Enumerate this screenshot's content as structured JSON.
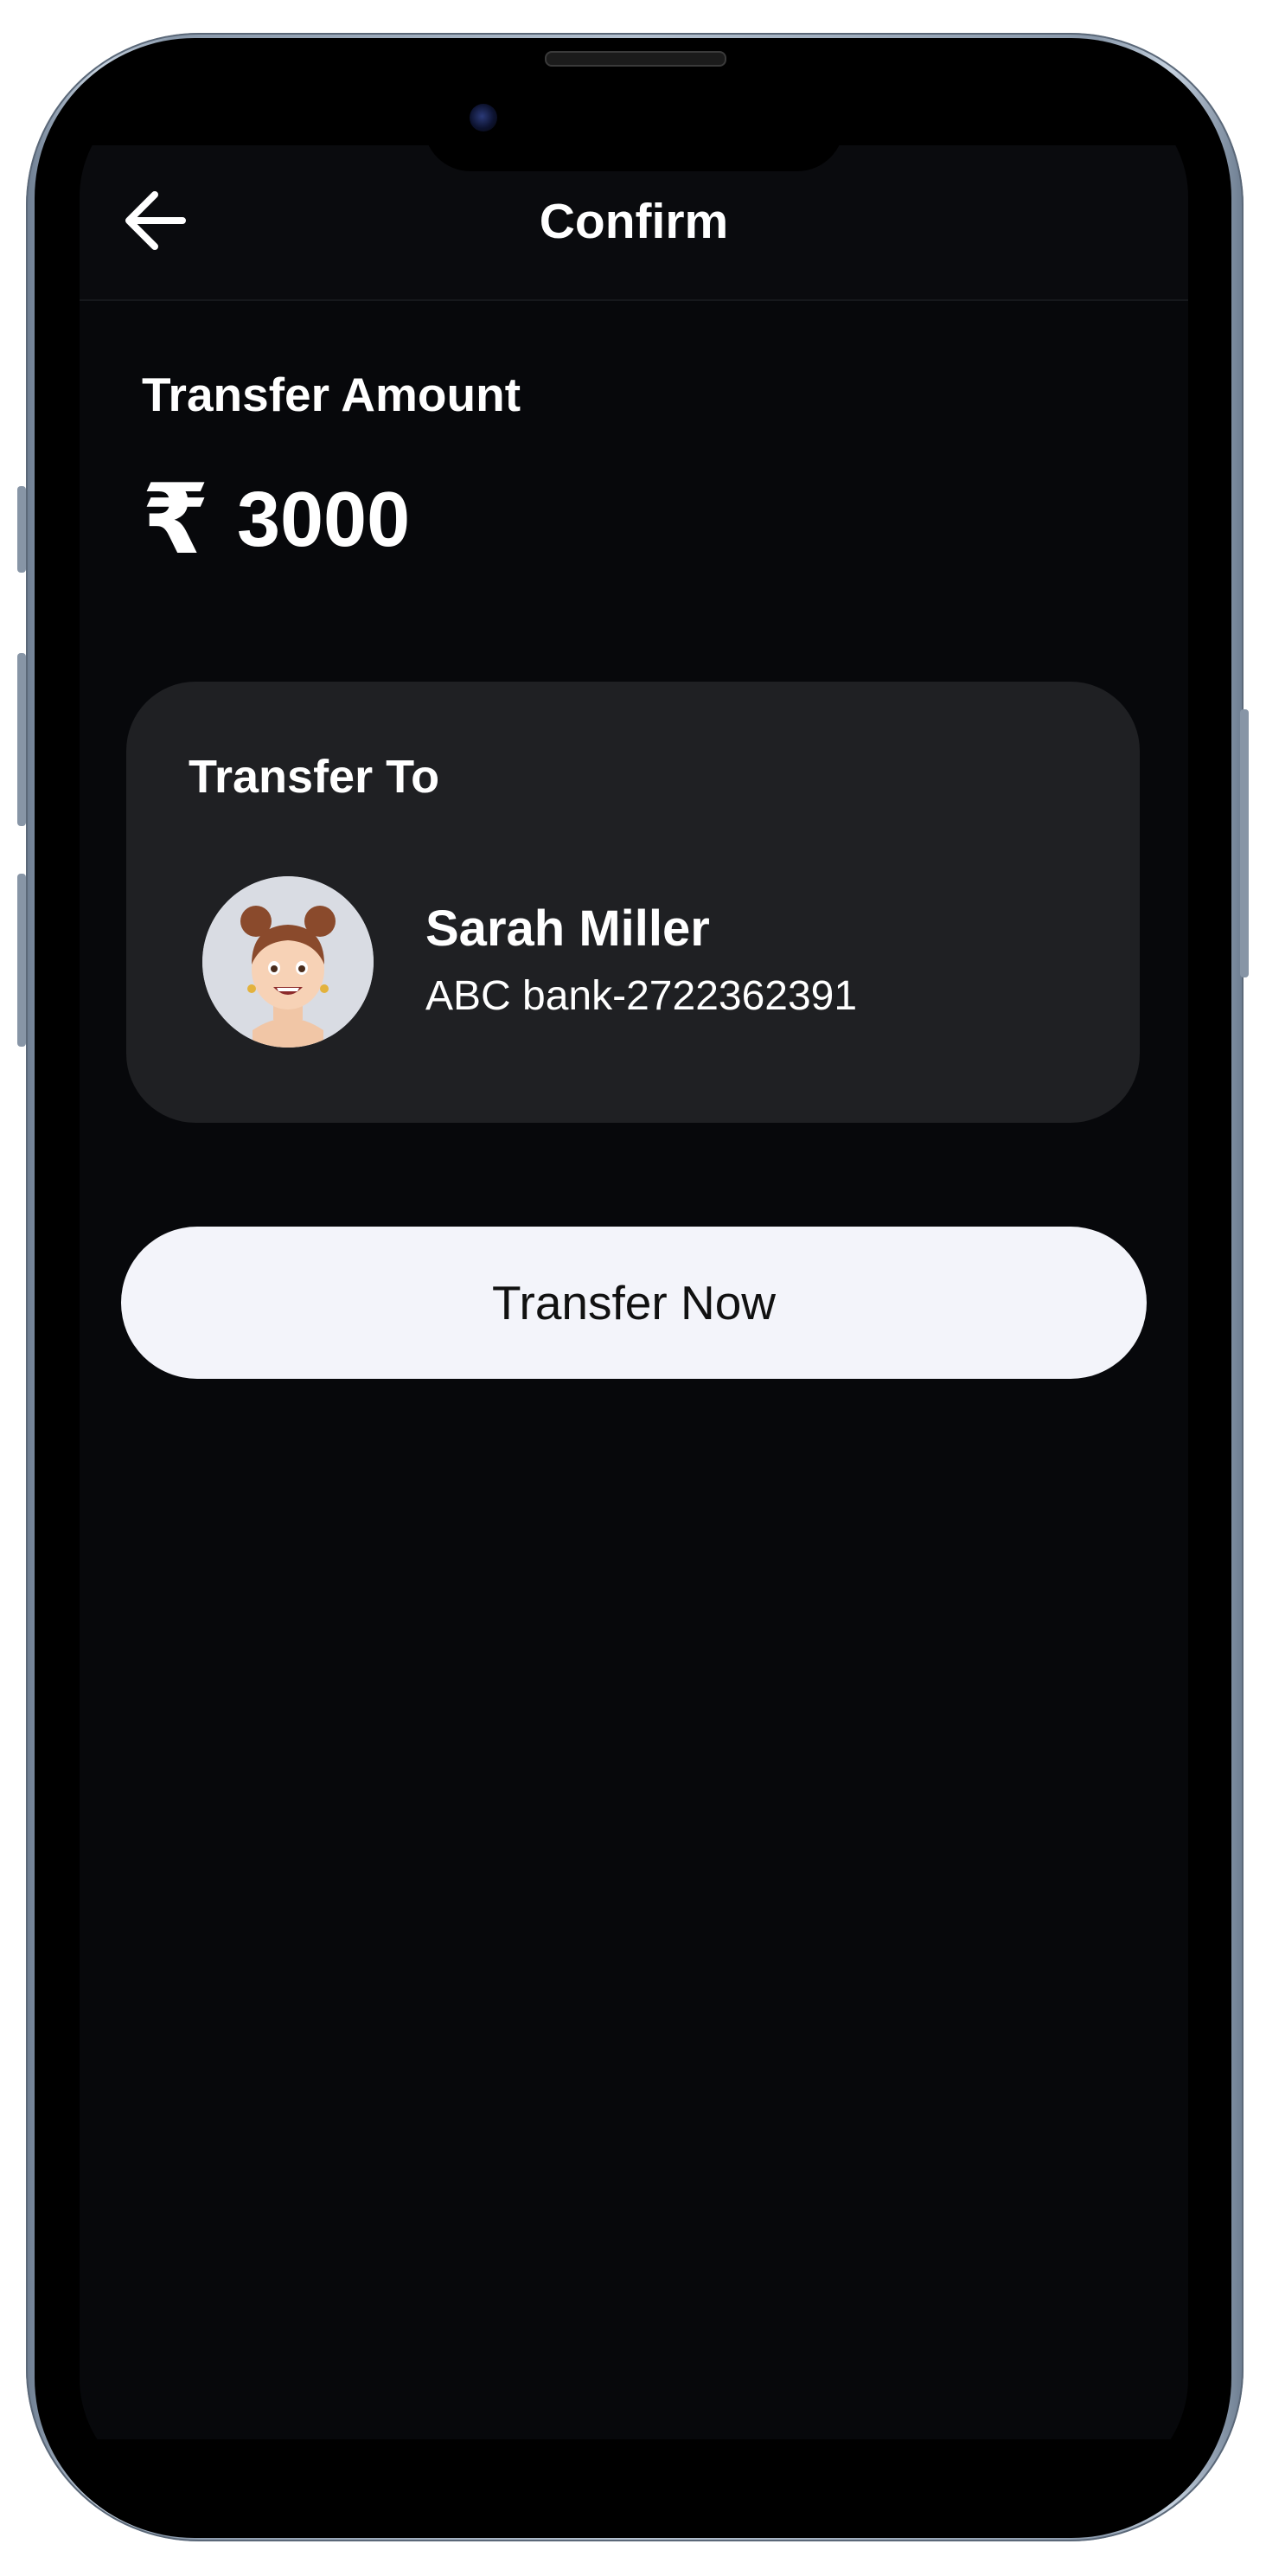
{
  "header": {
    "back_icon": "arrow-left-icon",
    "title": "Confirm"
  },
  "amount": {
    "label": "Transfer Amount",
    "currency_symbol": "₹",
    "value": "3000"
  },
  "recipient_card": {
    "title": "Transfer To",
    "avatar_icon": "memoji-avatar-icon",
    "name": "Sarah Miller",
    "account": "ABC bank-2722362391"
  },
  "actions": {
    "transfer_label": "Transfer Now"
  },
  "colors": {
    "background": "#07080b",
    "card": "#1f2023",
    "button": "#f3f4fa",
    "text": "#ffffff"
  }
}
